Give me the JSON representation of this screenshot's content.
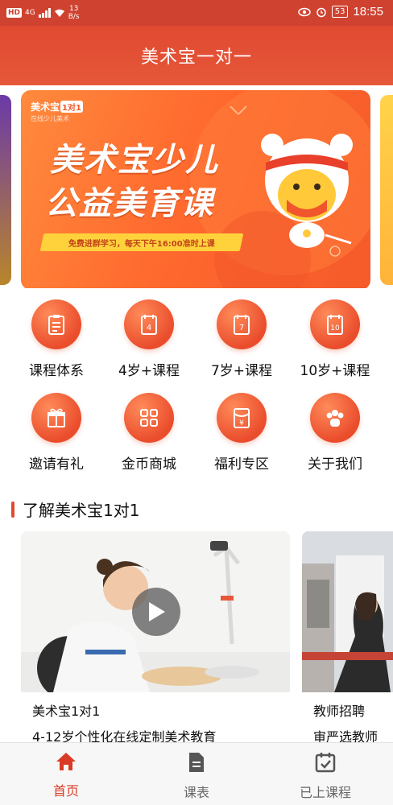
{
  "statusbar": {
    "hd": "HD",
    "network": "4G",
    "speed_value": "13",
    "speed_unit": "B/s",
    "battery": "53",
    "time": "18:55"
  },
  "appbar": {
    "title": "美术宝一对一"
  },
  "banner": {
    "logo": "美术宝",
    "logo_badge": "1对1",
    "logo_sub": "在线少儿美术",
    "headline_1": "美术宝少儿",
    "headline_2": "公益美育课",
    "strip_text": "免费进群学习，每天下午16:00准时上课"
  },
  "grid": [
    {
      "label": "课程体系",
      "icon": "clipboard-icon"
    },
    {
      "label": "4岁+课程",
      "icon": "calendar-4-icon",
      "num": "4"
    },
    {
      "label": "7岁+课程",
      "icon": "calendar-7-icon",
      "num": "7"
    },
    {
      "label": "10岁+课程",
      "icon": "calendar-10-icon",
      "num": "10"
    },
    {
      "label": "邀请有礼",
      "icon": "gift-icon"
    },
    {
      "label": "金币商城",
      "icon": "apps-grid-icon"
    },
    {
      "label": "福利专区",
      "icon": "red-envelope-icon"
    },
    {
      "label": "关于我们",
      "icon": "people-icon"
    }
  ],
  "section": {
    "title": "了解美术宝1对1"
  },
  "cards": [
    {
      "title": "美术宝1对1",
      "desc": "4-12岁个性化在线定制美术教育"
    },
    {
      "title": "教师招聘",
      "desc": "审严选教师"
    }
  ],
  "tabs": [
    {
      "label": "首页",
      "icon": "home-icon"
    },
    {
      "label": "课表",
      "icon": "document-icon"
    },
    {
      "label": "已上课程",
      "icon": "calendar-check-icon"
    }
  ],
  "colors": {
    "brand": "#e04a32",
    "active_tab": "#d93c25"
  }
}
